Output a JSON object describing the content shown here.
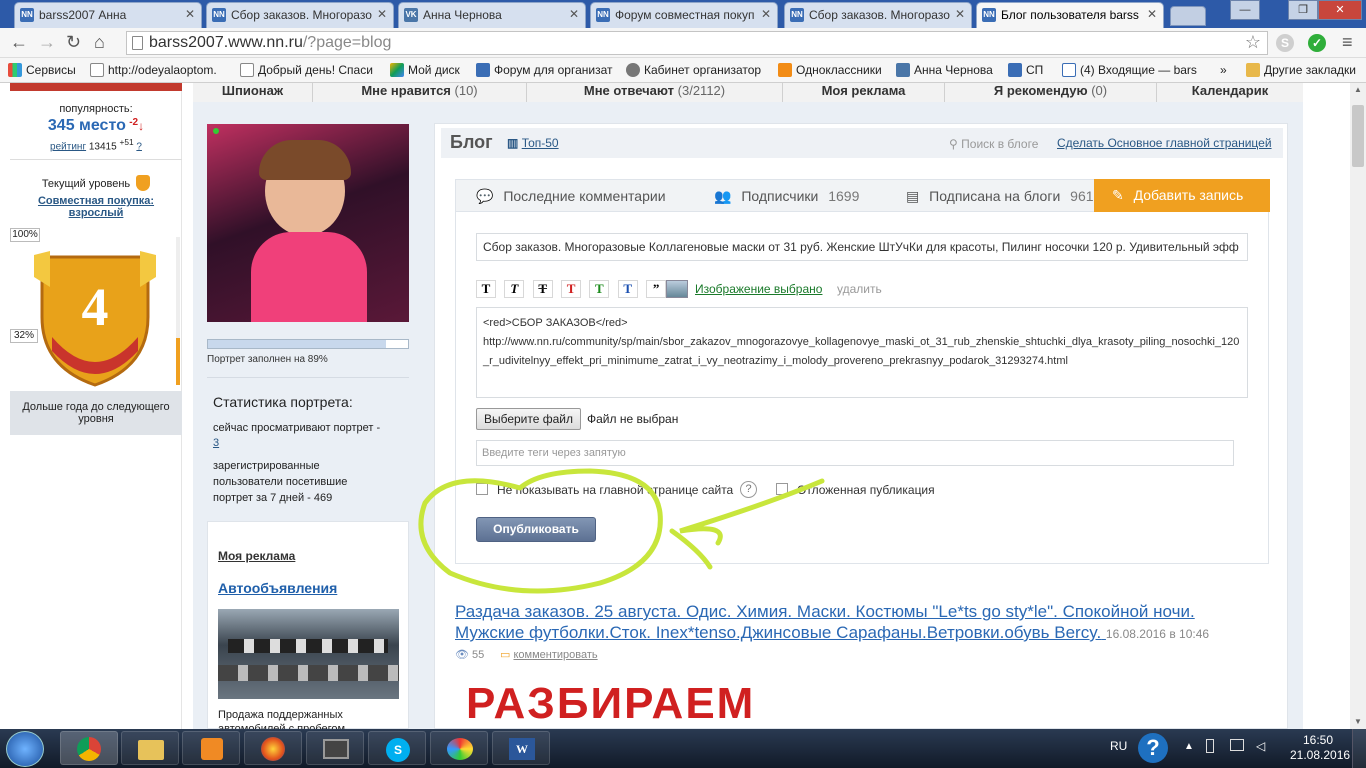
{
  "browser": {
    "tabs": [
      {
        "label": "barss2007 Анна",
        "favicon": "NN"
      },
      {
        "label": "Сбор заказов. Многоразо",
        "favicon": "NN"
      },
      {
        "label": "Анна Чернова",
        "favicon": "VK"
      },
      {
        "label": "Форум совместная покуп",
        "favicon": "NN"
      },
      {
        "label": "Сбор заказов. Многоразо",
        "favicon": "NN"
      },
      {
        "label": "Блог пользователя barss",
        "favicon": "NN"
      }
    ],
    "url_host": "barss2007.www.nn.ru",
    "url_path": "/?page=blog",
    "bookmarks": [
      "Сервисы",
      "http://odeyalaoptom.",
      "Добрый день! Спаси",
      "Мой диск",
      "Форум для организат",
      "Кабинет организатор",
      "Одноклассники",
      "Анна Чернова",
      "СП",
      "(4) Входящие — bars"
    ],
    "bookmarks_more": "»",
    "other_bookmarks": "Другие закладки"
  },
  "topnav": {
    "items": [
      {
        "label": "Шпионаж",
        "count": ""
      },
      {
        "label": "Мне нравится",
        "count": "(10)"
      },
      {
        "label": "Мне отвечают",
        "count": "(3/2112)"
      },
      {
        "label": "Моя реклама",
        "count": ""
      },
      {
        "label": "Я рекомендую",
        "count": "(0)"
      },
      {
        "label": "Календарик",
        "count": ""
      }
    ]
  },
  "left": {
    "popularity_label": "популярность:",
    "place": "345 место",
    "place_change": "-2",
    "rating_link": "рейтинг",
    "rating_value": "13415",
    "rating_delta": "+51",
    "help": "?",
    "level_label": "Текущий уровень",
    "level_link": "Совместная покупка: взрослый",
    "level_number": "4",
    "scale_top": "100%",
    "scale_mid": "32%",
    "next_level": "Дольше года до следующего уровня"
  },
  "profile": {
    "photo_fill": 0.89,
    "fill_text": "Портрет заполнен на 89%",
    "stats_title": "Статистика портрета:",
    "stats_now_prefix": "сейчас просматривают портрет -",
    "stats_now_value": "3",
    "stats_week": "зарегистрированные пользователи посетившие портрет за 7 дней - 469",
    "ads_title": "Моя реклама",
    "ads_link": "Автообъявления",
    "ads_text": "Продажа поддержанных автомобилей с пробегом"
  },
  "blog": {
    "title": "Блог",
    "top50": "Топ-50",
    "search_placeholder": "Поиск в блоге",
    "make_main": "Сделать Основное главной страницей",
    "tabs": [
      {
        "label": "Последние комментарии",
        "count": ""
      },
      {
        "label": "Подписчики",
        "count": "1699"
      },
      {
        "label": "Подписана на блоги",
        "count": "961"
      }
    ],
    "add_post": "Добавить запись",
    "title_input": "Сбор заказов. Многоразовые Коллагеновые маски от 31 руб. Женские ШтУчКи для красоты, Пилинг носочки 120 р. Удивительный эфф",
    "format_buttons": [
      "T",
      "T",
      "T",
      "T",
      "T",
      "T",
      "”"
    ],
    "format_colors": [
      "#000000",
      "#000000",
      "#000000",
      "#d02020",
      "#1a8a1a",
      "#1a4fb0",
      "#000000"
    ],
    "image_selected": "Изображение выбрано",
    "delete": "удалить",
    "body_line1": "<red>СБОР ЗАКАЗОВ</red>",
    "body_line2": "http://www.nn.ru/community/sp/main/sbor_zakazov_mnogorazovye_kollagenovye_maski_ot_31_rub_zhenskie_shtuchki_dlya_krasoty_piling_nosochki_120_r_udivitelnyy_effekt_pri_minimume_zatrat_i_vy_neotrazimy_i_molody_provereno_prekrasnyy_podarok_31293274.html",
    "choose_file": "Выберите файл",
    "no_file": "Файл не выбран",
    "tags_placeholder": "Введите теги через запятую",
    "hide_on_main": "Не показывать на главной странице сайта",
    "help_icon": "?",
    "delayed": "Отложенная публикация",
    "publish": "Опубликовать",
    "post_title": "Раздача заказов. 25 августа. Одис. Химия. Маски. Костюмы \"Le*ts go sty*le\". Спокойной ночи. Мужские футболки.Сток. Inex*tenso.Джинсовые Сарафаны.Ветровки.обувь Bercy.",
    "post_date": "16.08.2016 в 10:46",
    "post_views": "55",
    "post_comment": "комментировать",
    "post_image_text": "РАЗБИРАЕМ"
  },
  "taskbar": {
    "lang": "RU",
    "time": "16:50",
    "date": "21.08.2016"
  },
  "colors": {
    "tab_bar": "#2d5aa8",
    "accent_orange": "#f0a020",
    "link_blue": "#2a5885",
    "annotation_green": "#c8e63c",
    "publish_button": "#6a7f9e"
  }
}
